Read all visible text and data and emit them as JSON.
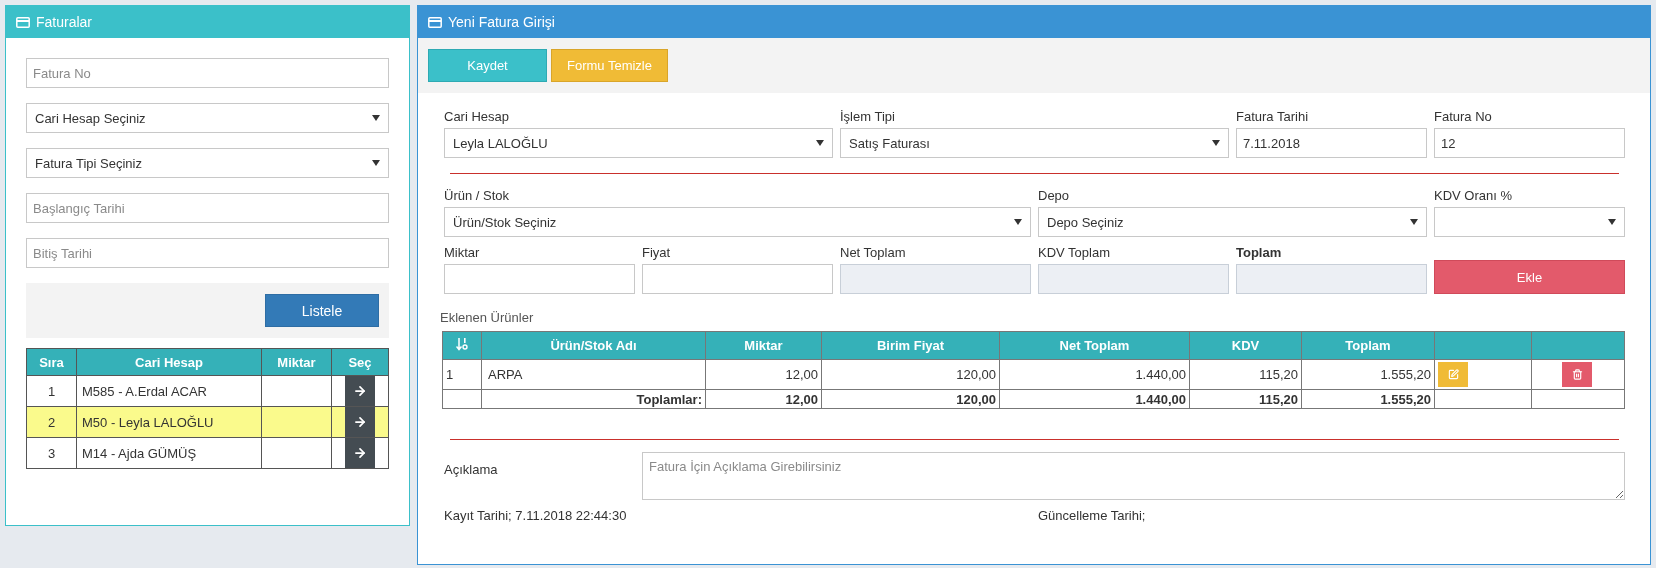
{
  "left_panel": {
    "title": "Faturalar",
    "filters": [
      {
        "kind": "input",
        "placeholder": "Fatura No"
      },
      {
        "kind": "select",
        "value": "Cari Hesap Seçiniz"
      },
      {
        "kind": "select",
        "value": "Fatura Tipi Seçiniz"
      },
      {
        "kind": "input",
        "placeholder": "Başlangıç Tarihi"
      },
      {
        "kind": "input",
        "placeholder": "Bitiş Tarihi"
      }
    ],
    "list_button": "Listele",
    "table": {
      "columns": [
        "Sıra",
        "Cari Hesap",
        "Miktar",
        "Seç"
      ],
      "rows": [
        {
          "sira": "1",
          "cari_hesap": "M585 - A.Erdal ACAR",
          "selected": false
        },
        {
          "sira": "2",
          "cari_hesap": "M50 - Leyla LALOĞLU",
          "selected": true
        },
        {
          "sira": "3",
          "cari_hesap": "M14 - Ajda GÜMÜŞ",
          "selected": false
        }
      ]
    }
  },
  "right_panel": {
    "title": "Yeni Fatura Girişi",
    "buttons": [
      {
        "kind": "primary",
        "label": "Kaydet"
      },
      {
        "kind": "warning",
        "label": "Formu Temizle"
      }
    ],
    "header_fields": [
      {
        "kind": "select",
        "label": "Cari Hesap",
        "value": "Leyla LALOĞLU"
      },
      {
        "kind": "select",
        "label": "İşlem Tipi",
        "value": "Satış Faturası"
      },
      {
        "kind": "input",
        "label": "Fatura Tarihi",
        "value": "7.11.2018"
      },
      {
        "kind": "input",
        "label": "Fatura No",
        "value": "12"
      }
    ],
    "product_fields": [
      {
        "kind": "select",
        "label": "Ürün / Stok",
        "value": "Ürün/Stok Seçiniz"
      },
      {
        "kind": "select",
        "label": "Depo",
        "value": "Depo Seçiniz"
      },
      {
        "kind": "select",
        "label": "KDV Oranı %"
      }
    ],
    "amount_fields": [
      {
        "kind": "input",
        "label": "Miktar",
        "bold": false
      },
      {
        "kind": "input",
        "label": "Fiyat",
        "bold": false
      },
      {
        "kind": "readonly",
        "label": "Net Toplam",
        "bold": false
      },
      {
        "kind": "readonly",
        "label": "KDV Toplam",
        "bold": false
      },
      {
        "kind": "readonly",
        "label": "Toplam",
        "bold": true
      },
      {
        "kind": "button",
        "label": "Ekle"
      }
    ],
    "products_title": "Eklenen Ürünler",
    "products_table": {
      "columns": [
        "Ürün/Stok Adı",
        "Miktar",
        "Birim Fiyat",
        "Net Toplam",
        "KDV",
        "Toplam"
      ],
      "rows": [
        {
          "no": "1",
          "name": "ARPA",
          "values": [
            "12,00",
            "120,00",
            "1.440,00",
            "115,20",
            "1.555,20"
          ]
        }
      ],
      "totals": {
        "label": "Toplamlar:",
        "values": [
          "12,00",
          "120,00",
          "1.440,00",
          "115,20",
          "1.555,20"
        ]
      }
    },
    "note": {
      "label": "Açıklama",
      "placeholder": "Fatura İçin Açıklama Girebilirsiniz"
    },
    "footer": [
      "Kayıt Tarihi; 7.11.2018 22:44:30",
      "Güncelleme Tarihi;"
    ]
  }
}
